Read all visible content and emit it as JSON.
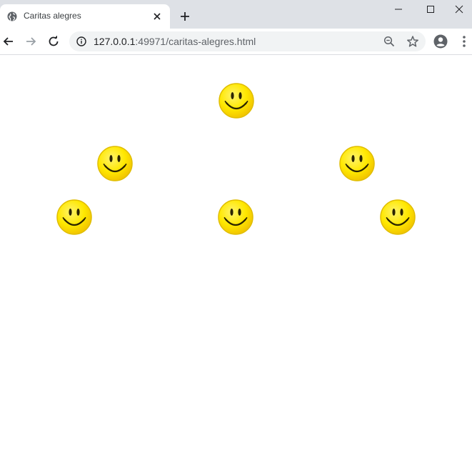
{
  "browser": {
    "tab": {
      "title": "Caritas alegres",
      "favicon": "globe-icon"
    },
    "url": {
      "host": "127.0.0.1",
      "rest": ":49971/caritas-alegres.html"
    },
    "icons": {
      "back": "arrow-left-icon",
      "forward": "arrow-right-icon",
      "reload": "reload-icon",
      "info": "info-icon",
      "zoom": "zoom-out-icon",
      "bookmark": "star-icon",
      "profile": "account-icon",
      "menu": "kebab-menu-icon",
      "new_tab": "plus-icon",
      "close_tab": "close-icon"
    }
  },
  "page": {
    "smileys": [
      {
        "name": "smiley-top-center"
      },
      {
        "name": "smiley-middle-left"
      },
      {
        "name": "smiley-middle-right"
      },
      {
        "name": "smiley-bottom-left"
      },
      {
        "name": "smiley-bottom-center"
      },
      {
        "name": "smiley-bottom-right"
      }
    ]
  },
  "colors": {
    "smiley_fill": "#ffe800",
    "smiley_edge": "#e0bd00",
    "smiley_features": "#2b2400"
  }
}
